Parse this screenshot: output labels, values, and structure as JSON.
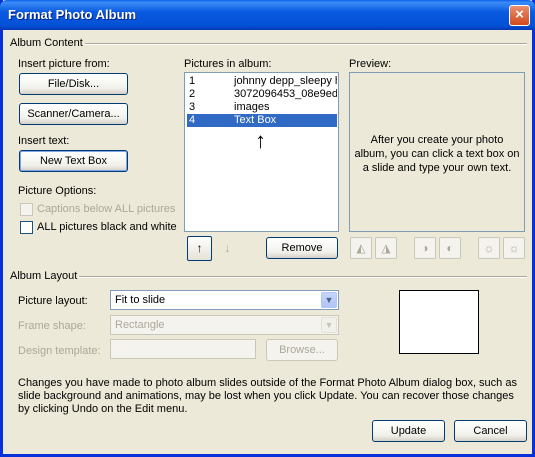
{
  "window": {
    "title": "Format Photo Album",
    "close_icon": "×"
  },
  "album_content": {
    "label": "Album Content",
    "insert_picture_from_label": "Insert picture from:",
    "file_disk_button": "File/Disk...",
    "scanner_camera_button": "Scanner/Camera...",
    "insert_text_label": "Insert text:",
    "new_text_box_button": "New Text Box",
    "picture_options_label": "Picture Options:",
    "captions_checkbox_label": "Captions below ALL pictures",
    "captions_checked": false,
    "black_white_checkbox_label": "ALL pictures black and white",
    "black_white_checked": false,
    "pictures_in_album_label": "Pictures in album:",
    "pictures": [
      {
        "num": "1",
        "name": "johnny depp_sleepy h"
      },
      {
        "num": "2",
        "name": "3072096453_08e9edl"
      },
      {
        "num": "3",
        "name": "images"
      },
      {
        "num": "4",
        "name": "Text Box"
      }
    ],
    "selected_index": 3,
    "cursor_arrow": "↑",
    "move_up_icon": "↑",
    "move_down_icon": "↓",
    "remove_button": "Remove",
    "preview_label": "Preview:",
    "preview_text": "After you create your photo album, you can click a text box on a slide and type your own text.",
    "rotate_left_icon": "◭",
    "rotate_right_icon": "◮",
    "contrast_up_icon": "◑",
    "contrast_down_icon": "◐",
    "brightness_up_icon": "☼",
    "brightness_down_icon": "☼"
  },
  "album_layout": {
    "label": "Album Layout",
    "picture_layout_label": "Picture layout:",
    "picture_layout_value": "Fit to slide",
    "frame_shape_label": "Frame shape:",
    "frame_shape_value": "Rectangle",
    "design_template_label": "Design template:",
    "design_template_value": "",
    "browse_button": "Browse..."
  },
  "footer": {
    "notice": "Changes you have made to photo album slides outside of the Format Photo Album dialog box, such as slide background and animations, may be lost when you click Update. You can recover those changes by clicking Undo on the Edit menu.",
    "update_button": "Update",
    "cancel_button": "Cancel"
  },
  "colors": {
    "titlebar": "#0a5ae0",
    "selection": "#316ac5",
    "dialog_bg": "#ece9d8"
  }
}
